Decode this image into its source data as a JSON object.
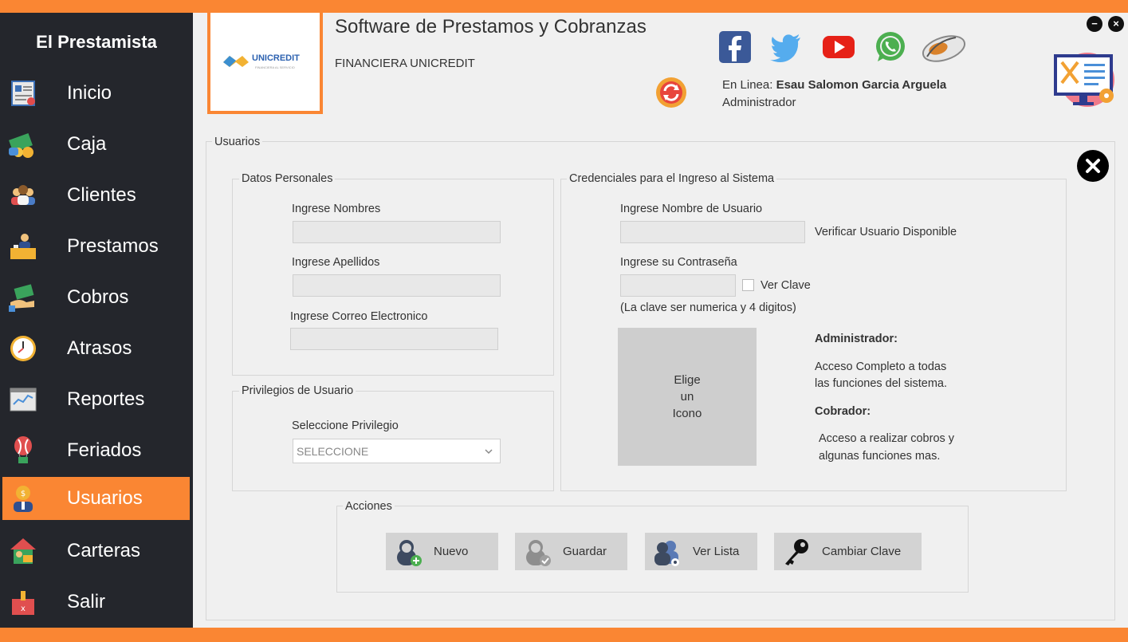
{
  "app": {
    "brand": "El Prestamista",
    "title": "Software de Prestamos y Cobranzas",
    "subtitle": "FINANCIERA UNICREDIT",
    "logo_text": "UNICREDIT",
    "logo_tagline": "FINANCIERA AL SERVICIO"
  },
  "colors": {
    "accent": "#fa8633",
    "sidebar": "#24262c",
    "panel": "#f0f0f0"
  },
  "sidebar": {
    "items": [
      {
        "label": "Inicio",
        "icon": "document-icon"
      },
      {
        "label": "Caja",
        "icon": "cash-icon"
      },
      {
        "label": "Clientes",
        "icon": "people-icon"
      },
      {
        "label": "Prestamos",
        "icon": "desk-icon"
      },
      {
        "label": "Cobros",
        "icon": "money-hand-icon"
      },
      {
        "label": "Atrasos",
        "icon": "clock-icon"
      },
      {
        "label": "Reportes",
        "icon": "chart-icon"
      },
      {
        "label": "Feriados",
        "icon": "balloon-icon"
      },
      {
        "label": "Usuarios",
        "icon": "user-icon",
        "active": true
      },
      {
        "label": "Carteras",
        "icon": "house-icon"
      },
      {
        "label": "Salir",
        "icon": "exit-icon"
      }
    ]
  },
  "header": {
    "online_prefix": "En Linea:",
    "user_name": "Esau Salomon Garcia Arguela",
    "role": "Administrador",
    "social": [
      "facebook-icon",
      "twitter-icon",
      "youtube-icon",
      "whatsapp-icon",
      "mouse-icon"
    ]
  },
  "form": {
    "section_title": "Usuarios",
    "personal": {
      "title": "Datos Personales",
      "nombres_label": "Ingrese Nombres",
      "nombres_value": "",
      "apellidos_label": "Ingrese Apellidos",
      "apellidos_value": "",
      "correo_label": "Ingrese Correo Electronico",
      "correo_value": ""
    },
    "privileges": {
      "title": "Privilegios de Usuario",
      "select_label": "Seleccione Privilegio",
      "select_value": "SELECCIONE"
    },
    "credentials": {
      "title": "Credenciales para el Ingreso al Sistema",
      "usuario_label": "Ingrese Nombre de Usuario",
      "usuario_value": "",
      "verificar": "Verificar Usuario Disponible",
      "password_label": "Ingrese su Contraseña",
      "password_value": "",
      "ver_clave": "Ver Clave",
      "hint": "(La clave ser numerica y 4 digitos)",
      "icon_box": "Elige\nun\nIcono",
      "admin_title": "Administrador:",
      "admin_desc_1": "Acceso Completo a todas",
      "admin_desc_2": "las funciones del sistema.",
      "cobrador_title": "Cobrador:",
      "cobrador_desc_1": "Acceso a realizar cobros y",
      "cobrador_desc_2": "algunas funciones mas."
    },
    "actions": {
      "title": "Acciones",
      "nuevo": "Nuevo",
      "guardar": "Guardar",
      "ver_lista": "Ver Lista",
      "cambiar_clave": "Cambiar Clave"
    }
  }
}
